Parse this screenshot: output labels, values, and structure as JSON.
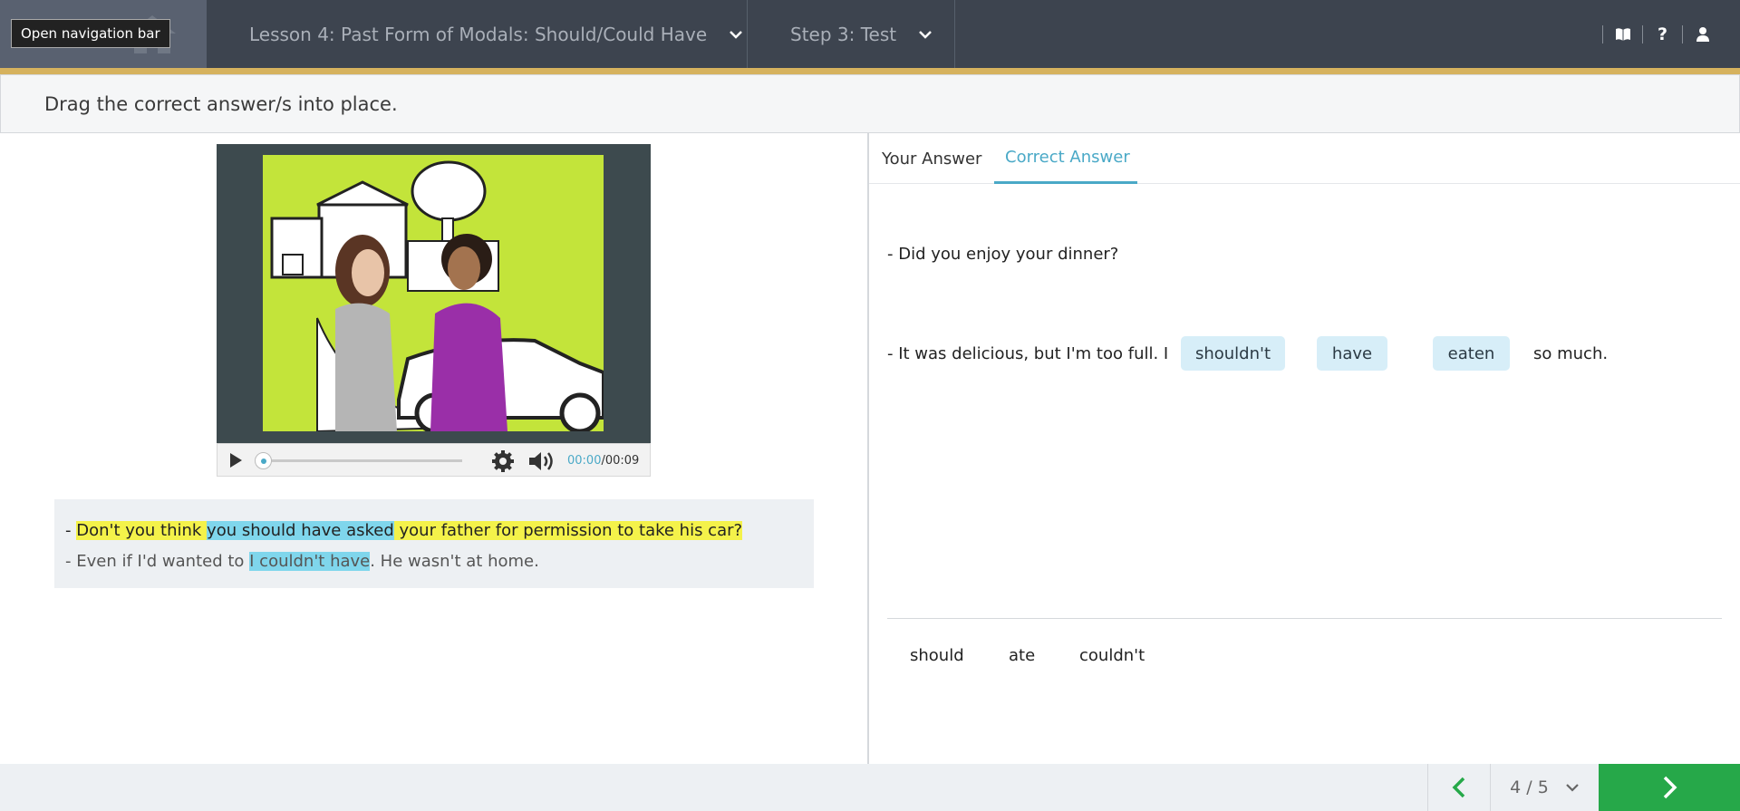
{
  "header": {
    "nav_tooltip": "Open navigation bar",
    "lesson_title": "Lesson 4: Past Form of Modals: Should/Could Have",
    "step_title": "Step 3: Test",
    "icons": [
      "home-icon",
      "book-icon",
      "help-icon",
      "user-icon"
    ],
    "help_glyph": "?"
  },
  "instruction": "Drag the correct answer/s into place.",
  "video": {
    "current_time": "00:00",
    "separator": "/",
    "duration": "00:09",
    "progress": 0
  },
  "transcript": {
    "line1": {
      "prefix": "- ",
      "part1": "Don't you think ",
      "highlight": "you should have asked",
      "part2": " your father for permission to take his car?"
    },
    "line2": {
      "part1": "- Even if I'd wanted to ",
      "highlight": "I couldn't have",
      "part2": ". He wasn't at home."
    }
  },
  "tabs": {
    "your_answer": "Your Answer",
    "correct_answer": "Correct Answer",
    "active": "correct_answer"
  },
  "exercise": {
    "line1": "- Did you enjoy your dinner?",
    "line2_prefix": "- It was delicious, but I'm too full. I",
    "answers": [
      "shouldn't",
      "have",
      "eaten"
    ],
    "line2_suffix": "so much.",
    "word_bank": [
      "should",
      "ate",
      "couldn't"
    ]
  },
  "footer": {
    "page_indicator": "4 / 5"
  },
  "colors": {
    "topbar": "#3d444f",
    "accent": "#d6b25e",
    "tab_active": "#4aa9c7",
    "chip": "#d7eef8",
    "next_button": "#26a849",
    "highlight_yellow": "#f4f24a",
    "highlight_blue": "#7fd6ec"
  }
}
